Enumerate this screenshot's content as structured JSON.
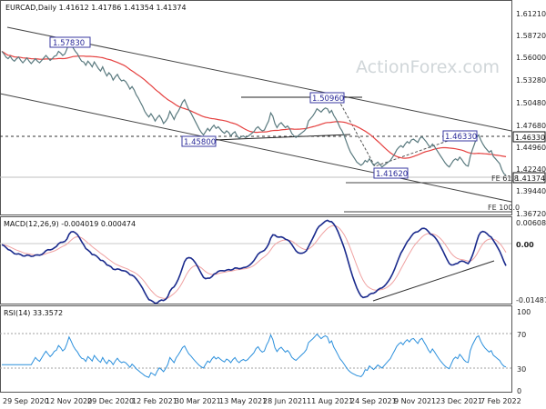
{
  "chart_data": [
    {
      "type": "line",
      "panel": "price",
      "title": "EURCAD,Daily  1.41612 1.41786 1.41354 1.41374",
      "watermark": "ActionForex.com",
      "ylim": [
        1.3672,
        1.6121
      ],
      "y_ticks": [
        "1.61210",
        "1.58720",
        "1.56000",
        "1.53280",
        "1.50480",
        "1.47680",
        "1.44960",
        "1.42240",
        "1.39440",
        "1.36720"
      ],
      "x_ticks": [
        "29 Sep 2020",
        "12 Nov 2020",
        "29 Dec 2020",
        "12 Feb 2021",
        "30 Mar 2021",
        "13 May 2021",
        "28 Jun 2021",
        "11 Aug 2021",
        "24 Sep 2021",
        "9 Nov 2021",
        "23 Dec 2021",
        "7 Feb 2022"
      ],
      "series": [
        {
          "style": "close",
          "color": "#5a7a7f",
          "values": [
            1.565,
            1.562,
            1.558,
            1.556,
            1.559,
            1.555,
            1.553,
            1.556,
            1.558,
            1.554,
            1.551,
            1.554,
            1.557,
            1.553,
            1.55,
            1.553,
            1.556,
            1.553,
            1.551,
            1.554,
            1.557,
            1.56,
            1.557,
            1.554,
            1.556,
            1.559,
            1.56,
            1.565,
            1.563,
            1.56,
            1.562,
            1.568,
            1.578,
            1.574,
            1.569,
            1.565,
            1.562,
            1.557,
            1.553,
            1.552,
            1.548,
            1.553,
            1.55,
            1.546,
            1.552,
            1.548,
            1.544,
            1.541,
            1.546,
            1.54,
            1.535,
            1.539,
            1.536,
            1.53,
            1.534,
            1.537,
            1.532,
            1.529,
            1.53,
            1.528,
            1.524,
            1.519,
            1.522,
            1.518,
            1.512,
            1.508,
            1.503,
            1.498,
            1.492,
            1.488,
            1.485,
            1.489,
            1.485,
            1.48,
            1.484,
            1.487,
            1.483,
            1.477,
            1.48,
            1.484,
            1.492,
            1.487,
            1.482,
            1.488,
            1.492,
            1.497,
            1.503,
            1.506,
            1.5,
            1.494,
            1.49,
            1.485,
            1.48,
            1.475,
            1.47,
            1.466,
            1.463,
            1.467,
            1.471,
            1.468,
            1.472,
            1.475,
            1.471,
            1.473,
            1.47,
            1.467,
            1.465,
            1.468,
            1.466,
            1.462,
            1.465,
            1.467,
            1.462,
            1.459,
            1.461,
            1.462,
            1.46,
            1.461,
            1.463,
            1.465,
            1.467,
            1.471,
            1.473,
            1.47,
            1.468,
            1.469,
            1.475,
            1.48,
            1.49,
            1.486,
            1.477,
            1.472,
            1.476,
            1.478,
            1.475,
            1.472,
            1.474,
            1.471,
            1.465,
            1.462,
            1.46,
            1.462,
            1.464,
            1.466,
            1.468,
            1.471,
            1.48,
            1.483,
            1.486,
            1.49,
            1.495,
            1.493,
            1.491,
            1.494,
            1.496,
            1.495,
            1.49,
            1.493,
            1.487,
            1.483,
            1.478,
            1.472,
            1.468,
            1.462,
            1.455,
            1.448,
            1.442,
            1.438,
            1.434,
            1.43,
            1.428,
            1.426,
            1.428,
            1.432,
            1.43,
            1.434,
            1.43,
            1.426,
            1.428,
            1.43,
            1.427,
            1.424,
            1.426,
            1.428,
            1.43,
            1.432,
            1.436,
            1.44,
            1.445,
            1.448,
            1.45,
            1.448,
            1.452,
            1.455,
            1.453,
            1.457,
            1.458,
            1.456,
            1.454,
            1.459,
            1.461,
            1.458,
            1.455,
            1.451,
            1.448,
            1.452,
            1.449,
            1.445,
            1.441,
            1.437,
            1.433,
            1.429,
            1.426,
            1.424,
            1.428,
            1.432,
            1.434,
            1.432,
            1.436,
            1.433,
            1.429,
            1.426,
            1.425,
            1.437,
            1.445,
            1.452,
            1.46,
            1.463,
            1.457,
            1.452,
            1.448,
            1.445,
            1.442,
            1.444,
            1.437,
            1.434,
            1.431,
            1.428,
            1.421,
            1.416,
            1.414
          ]
        },
        {
          "style": "moving-average",
          "color": "#e5403f"
        }
      ],
      "labels": [
        "1.57830",
        "1.50960",
        "1.45800",
        "1.46330",
        "1.41620"
      ],
      "right_markers": [
        {
          "text": "1.46330",
          "value": 1.4633,
          "boxed": true
        },
        {
          "text": "1.41374",
          "value": 1.41374,
          "boxed": true
        },
        {
          "text": "FE 61.8",
          "value": 1.4123
        },
        {
          "text": "FE 100.0",
          "value": 1.3722
        }
      ]
    },
    {
      "type": "line",
      "panel": "macd",
      "title": "MACD(12,26,9) -0.004019 0.000474",
      "ylim": [
        -0.014876,
        0.006084
      ],
      "y_ticks": [
        "0.006084",
        "0.00",
        "-0.014876"
      ],
      "series": [
        {
          "style": "macd",
          "color": "#1a2a8c"
        },
        {
          "style": "signal",
          "color": "#f0a2a2"
        }
      ]
    },
    {
      "type": "line",
      "panel": "rsi",
      "title": "RSI(14) 33.3572",
      "ylim": [
        0,
        100
      ],
      "y_ticks": [
        "100",
        "70",
        "30",
        "0"
      ],
      "series": [
        {
          "style": "rsi",
          "color": "#2a8fdc"
        }
      ]
    }
  ]
}
